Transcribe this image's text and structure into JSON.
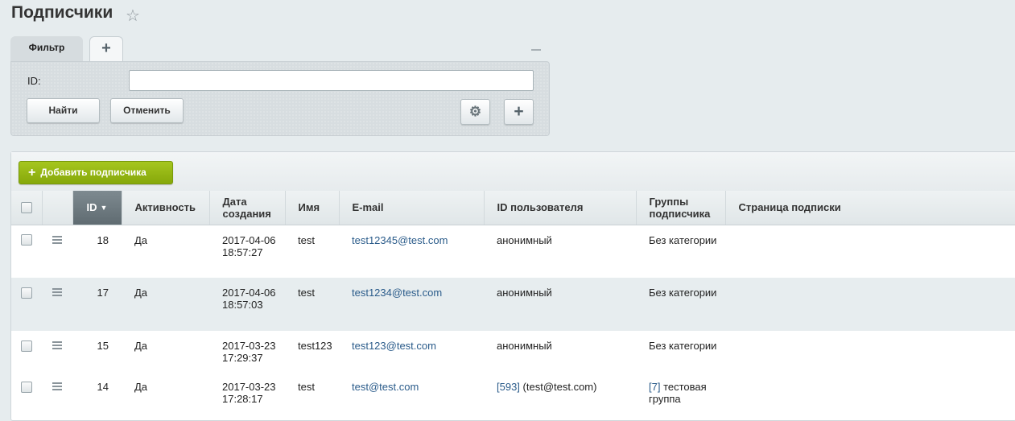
{
  "page": {
    "title": "Подписчики",
    "star_icon": "star-icon"
  },
  "filter": {
    "tab_label": "Фильтр",
    "add_tab_symbol": "+",
    "id_label": "ID:",
    "id_value": "",
    "find_label": "Найти",
    "cancel_label": "Отменить",
    "plus_symbol": "+",
    "gear_symbol": "⚙"
  },
  "toolbar": {
    "add_label": "Добавить подписчика",
    "add_symbol": "+"
  },
  "grid": {
    "columns": {
      "id": "ID",
      "active": "Активность",
      "created_line1": "Дата",
      "created_line2": "создания",
      "name": "Имя",
      "email": "E-mail",
      "user_id": "ID пользователя",
      "groups_line1": "Группы",
      "groups_line2": "подписчика",
      "page": "Страница подписки"
    },
    "rows": [
      {
        "id": "18",
        "active": "Да",
        "date": "2017-04-06",
        "time": "18:57:27",
        "name": "test",
        "email": "test12345@test.com",
        "user_link": "",
        "user_text": "анонимный",
        "group_link": "",
        "group_text": "Без категории",
        "page": ""
      },
      {
        "id": "17",
        "active": "Да",
        "date": "2017-04-06",
        "time": "18:57:03",
        "name": "test",
        "email": "test1234@test.com",
        "user_link": "",
        "user_text": "анонимный",
        "group_link": "",
        "group_text": "Без категории",
        "page": ""
      },
      {
        "id": "15",
        "active": "Да",
        "date": "2017-03-23",
        "time": "17:29:37",
        "name": "test123",
        "email": "test123@test.com",
        "user_link": "",
        "user_text": "анонимный",
        "group_link": "",
        "group_text": "Без категории",
        "page": ""
      },
      {
        "id": "14",
        "active": "Да",
        "date": "2017-03-23",
        "time": "17:28:17",
        "name": "test",
        "email": "test@test.com",
        "user_link": "[593]",
        "user_text": " (test@test.com)",
        "group_link": "[7]",
        "group_text": " тестовая группа",
        "page": ""
      }
    ]
  },
  "colors": {
    "accent_green": "#94b60f",
    "link": "#2a5b8a",
    "sorted_header": "#6b777d"
  }
}
